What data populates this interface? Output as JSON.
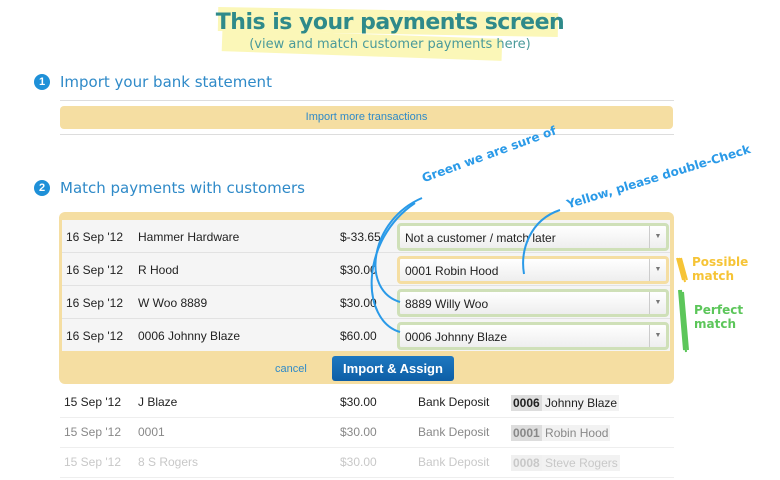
{
  "header": {
    "title": "This is your payments screen",
    "subtitle": "(view and match customer payments here)"
  },
  "step1": {
    "number": "1",
    "title": "Import your bank statement",
    "import_more": "Import more transactions"
  },
  "step2": {
    "number": "2",
    "title": "Match payments with customers"
  },
  "pending": [
    {
      "date": "16 Sep '12",
      "payee": "Hammer Hardware",
      "amount": "$-33.65",
      "match": "Not a customer / match later",
      "status": "green"
    },
    {
      "date": "16 Sep '12",
      "payee": "R Hood",
      "amount": "$30.00",
      "match": "0001 Robin Hood",
      "status": "yellow"
    },
    {
      "date": "16 Sep '12",
      "payee": "W Woo 8889",
      "amount": "$30.00",
      "match": "8889 Willy Woo",
      "status": "green"
    },
    {
      "date": "16 Sep '12",
      "payee": "0006 Johnny Blaze",
      "amount": "$60.00",
      "match": "0006 Johnny Blaze",
      "status": "green"
    }
  ],
  "actions": {
    "cancel": "cancel",
    "submit": "Import & Assign"
  },
  "history": [
    {
      "date": "15 Sep '12",
      "payee": "J Blaze",
      "amount": "$30.00",
      "type": "Bank Deposit",
      "code": "0006",
      "customer": "Johnny Blaze"
    },
    {
      "date": "15 Sep '12",
      "payee": "0001",
      "amount": "$30.00",
      "type": "Bank Deposit",
      "code": "0001",
      "customer": "Robin Hood"
    },
    {
      "date": "15 Sep '12",
      "payee": "8 S Rogers",
      "amount": "$30.00",
      "type": "Bank Deposit",
      "code": "0008",
      "customer": "Steve Rogers"
    }
  ],
  "annotations": {
    "green": "Green we are sure of",
    "yellow": "Yellow, please double-Check",
    "possible": "Possible match",
    "perfect": "Perfect match"
  },
  "colors": {
    "accent": "#2f8ac8",
    "panel": "#f5dea2",
    "green": "#5cc65a",
    "yellow": "#f6c436"
  }
}
